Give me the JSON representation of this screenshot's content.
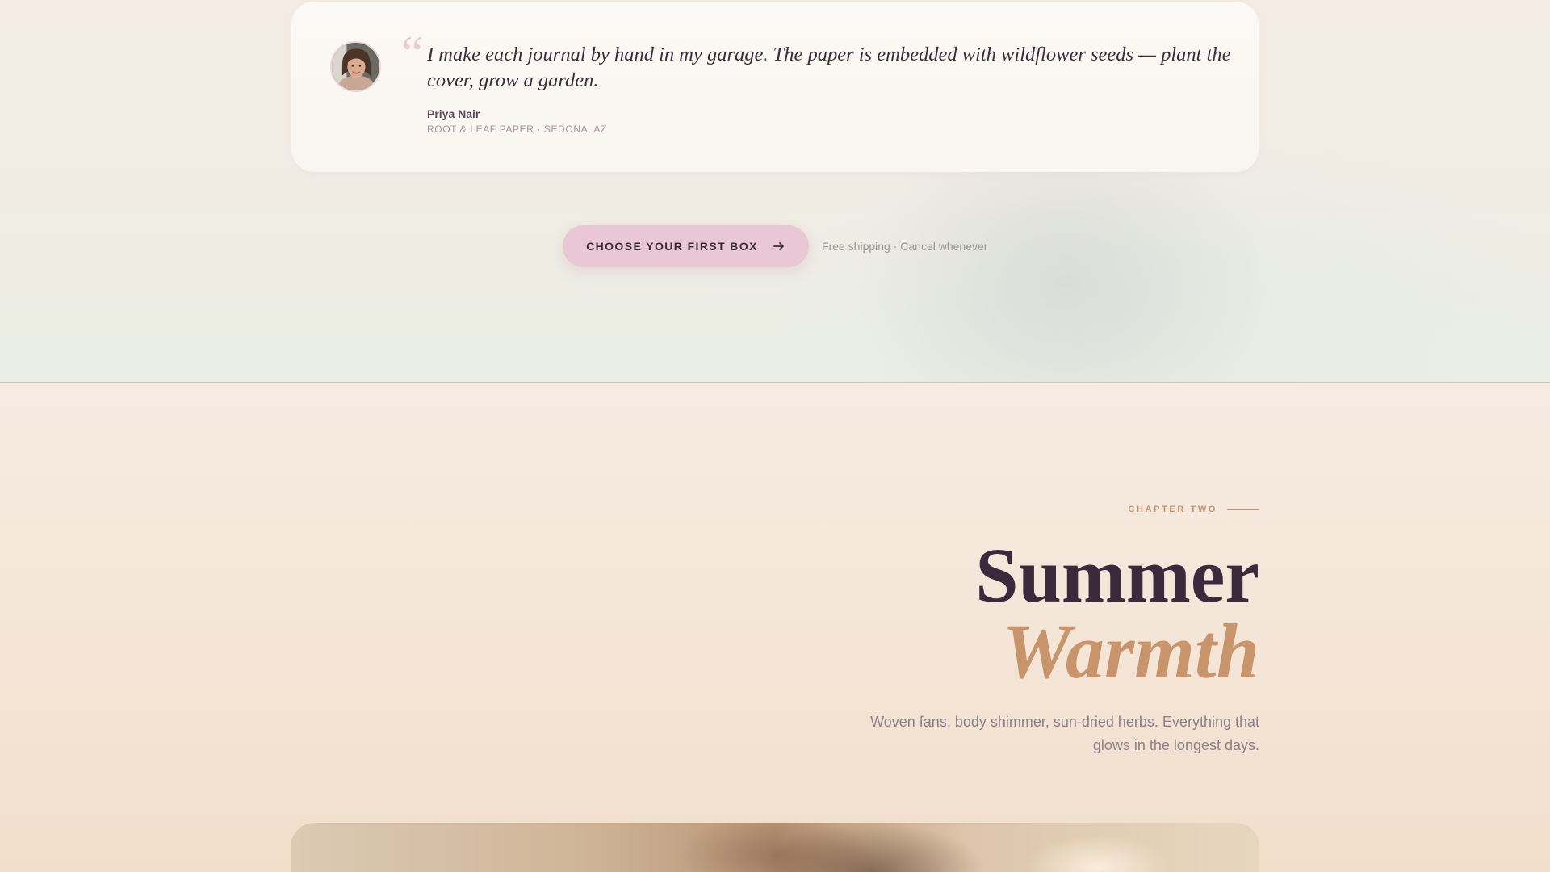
{
  "testimonial": {
    "avatar_icon": "portrait-avatar",
    "quote_mark": "“",
    "quote": "I make each journal by hand in my garage. The paper is embedded with wildflower seeds — plant the cover, grow a garden.",
    "author_name": "Priya Nair",
    "author_meta": "ROOT & LEAF PAPER · SEDONA, AZ"
  },
  "cta": {
    "button_label": "CHOOSE YOUR FIRST BOX",
    "button_icon": "arrow-right-icon",
    "note": "Free shipping · Cancel whenever"
  },
  "chapter": {
    "eyebrow": "CHAPTER TWO",
    "title_line_1": "Summer",
    "title_line_2": "Warmth",
    "description": "Woven fans, body shimmer, sun-dried herbs. Everything that glows in the longest days."
  },
  "colors": {
    "accent_pink": "#e9c7d5",
    "accent_tan": "#c7946b",
    "heading_dark": "#3b2a3c"
  }
}
